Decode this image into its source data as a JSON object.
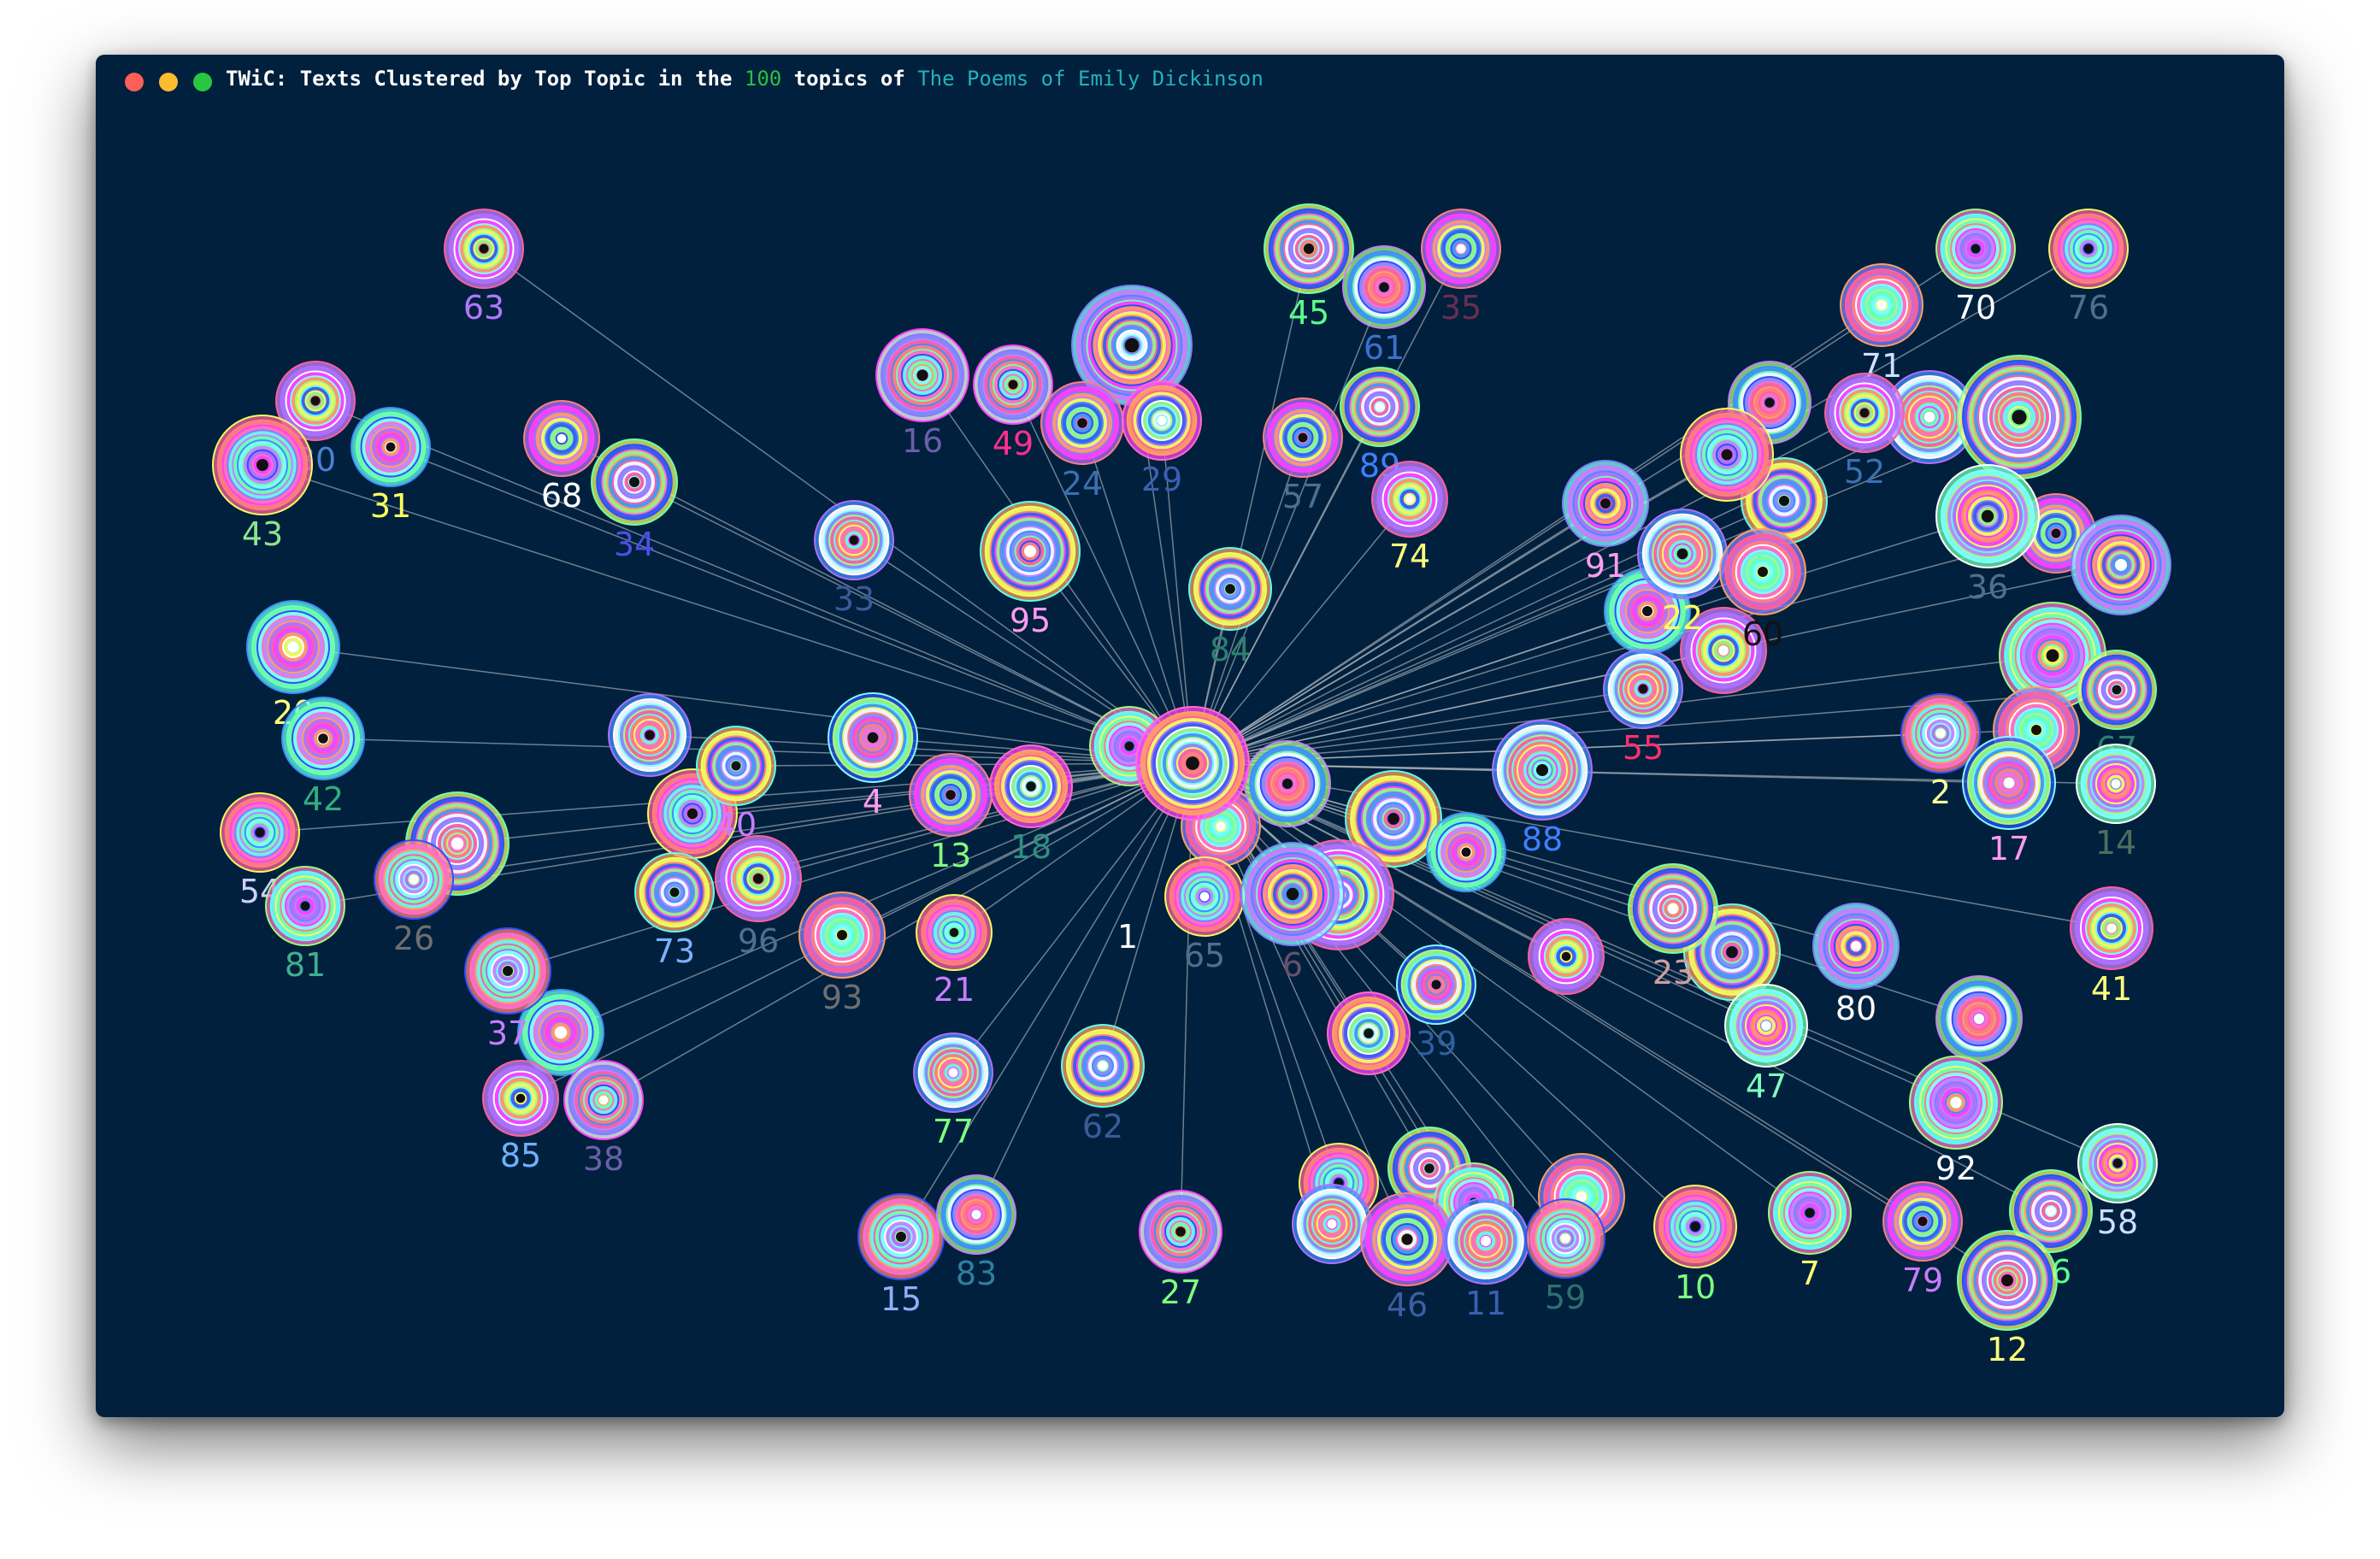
{
  "window": {
    "title_prefix": "TWiC: Texts Clustered by Top Topic in the ",
    "topic_count": "100",
    "title_middle": " topics of ",
    "corpus_name": "The Poems of Emily Dickinson",
    "count_color": "#2bbf3f",
    "corpus_color": "#21b2bb",
    "background": "#00203d",
    "traffic_lights": [
      {
        "name": "close",
        "color": "#fc5f57"
      },
      {
        "name": "minimize",
        "color": "#fdbc2e"
      },
      {
        "name": "maximize",
        "color": "#27c840"
      }
    ]
  },
  "graph": {
    "hub_label": "1",
    "link_color": "#c9cdd3",
    "nodes": [
      {
        "label": "63",
        "color": "#b277ff"
      },
      {
        "label": "30",
        "color": "#4f7fd0"
      },
      {
        "label": "31",
        "color": "#ffff5e"
      },
      {
        "label": "43",
        "color": "#8fe38f"
      },
      {
        "label": "68",
        "color": "#ffffff"
      },
      {
        "label": "34",
        "color": "#4e4ee6"
      },
      {
        "label": "33",
        "color": "#3b5a9a"
      },
      {
        "label": "16",
        "color": "#6a5fa8"
      },
      {
        "label": "49",
        "color": "#ff2f8f"
      },
      {
        "label": "24",
        "color": "#3b6fb0"
      },
      {
        "label": "29",
        "color": "#3b5fb0"
      },
      {
        "label": "95",
        "color": "#ff9cf0"
      },
      {
        "label": "45",
        "color": "#5cff8a"
      },
      {
        "label": "61",
        "color": "#3b6fd0"
      },
      {
        "label": "35",
        "color": "#6a2f4f"
      },
      {
        "label": "89",
        "color": "#3f7fff"
      },
      {
        "label": "57",
        "color": "#4f6f8f"
      },
      {
        "label": "74",
        "color": "#ffff7a"
      },
      {
        "label": "84",
        "color": "#2f7f6f"
      },
      {
        "label": "20",
        "color": "#ffff7a"
      },
      {
        "label": "42",
        "color": "#2faf7f"
      },
      {
        "label": "4",
        "color": "#ff9cf0"
      },
      {
        "label": "40",
        "color": "#c77dff"
      },
      {
        "label": "13",
        "color": "#7fff7f"
      },
      {
        "label": "18",
        "color": "#2f8f7f"
      },
      {
        "label": "54",
        "color": "#cfcfff"
      },
      {
        "label": "81",
        "color": "#3faf8f"
      },
      {
        "label": "26",
        "color": "#6f6f6f"
      },
      {
        "label": "73",
        "color": "#7fafff"
      },
      {
        "label": "96",
        "color": "#4f6f8f"
      },
      {
        "label": "93",
        "color": "#6f6f6f"
      },
      {
        "label": "21",
        "color": "#c77dff"
      },
      {
        "label": "37",
        "color": "#c77dff"
      },
      {
        "label": "85",
        "color": "#6fb0ff"
      },
      {
        "label": "38",
        "color": "#6a5fa8"
      },
      {
        "label": "77",
        "color": "#7fff7f"
      },
      {
        "label": "62",
        "color": "#3b5a9a"
      },
      {
        "label": "15",
        "color": "#8fafff"
      },
      {
        "label": "83",
        "color": "#2f7f9f"
      },
      {
        "label": "27",
        "color": "#7fff7f"
      },
      {
        "label": "65",
        "color": "#4f6f8f"
      },
      {
        "label": "6",
        "color": "#6a4f6f"
      },
      {
        "label": "88",
        "color": "#3f7fff"
      },
      {
        "label": "39",
        "color": "#2f5f9f"
      },
      {
        "label": "46",
        "color": "#3b5fa0"
      },
      {
        "label": "11",
        "color": "#3b5fb0"
      },
      {
        "label": "59",
        "color": "#2f6f6f"
      },
      {
        "label": "10",
        "color": "#7fff7f"
      },
      {
        "label": "7",
        "color": "#ffff7a"
      },
      {
        "label": "91",
        "color": "#ff9cf0"
      },
      {
        "label": "22",
        "color": "#ffff5e"
      },
      {
        "label": "60",
        "color": "#111111"
      },
      {
        "label": "55",
        "color": "#ff2f6f"
      },
      {
        "label": "23",
        "color": "#cf9f9f"
      },
      {
        "label": "47",
        "color": "#7fffbf"
      },
      {
        "label": "80",
        "color": "#ffffff"
      },
      {
        "label": "70",
        "color": "#ffffff"
      },
      {
        "label": "76",
        "color": "#4f6f8f"
      },
      {
        "label": "71",
        "color": "#cfdfff"
      },
      {
        "label": "52",
        "color": "#3b6fb0"
      },
      {
        "label": "36",
        "color": "#4f6f8f"
      },
      {
        "label": "2",
        "color": "#ffff9f"
      },
      {
        "label": "17",
        "color": "#ff9cf0"
      },
      {
        "label": "67",
        "color": "#2f7f6f"
      },
      {
        "label": "14",
        "color": "#4f6f5f"
      },
      {
        "label": "41",
        "color": "#ffff7a"
      },
      {
        "label": "92",
        "color": "#ffffff"
      },
      {
        "label": "79",
        "color": "#c77dff"
      },
      {
        "label": "56",
        "color": "#5cff8a"
      },
      {
        "label": "58",
        "color": "#cfdfff"
      },
      {
        "label": "12",
        "color": "#ffff7a"
      }
    ]
  }
}
